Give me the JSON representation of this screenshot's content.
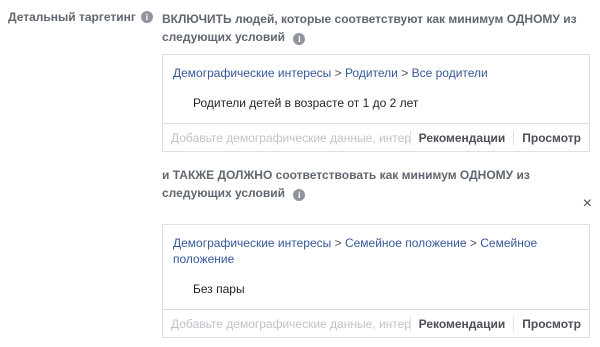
{
  "left_label": "Детальный таргетинг",
  "include": {
    "heading": "ВКЛЮЧИТЬ людей, которые соответствуют как минимум ОДНОМУ из следующих условий",
    "crumbs": [
      "Демографические интересы",
      "Родители",
      "Все родители"
    ],
    "item": "Родители детей в возрасте от 1 до 2 лет",
    "search_placeholder": "Добавьте демографические данные, интер...",
    "recommendations": "Рекомендации",
    "browse": "Просмотр"
  },
  "narrow": {
    "heading": "и ТАКЖЕ ДОЛЖНО соответствовать как минимум ОДНОМУ из следующих условий",
    "crumbs": [
      "Демографические интересы",
      "Семейное положение",
      "Семейное положение"
    ],
    "item": "Без пары",
    "search_placeholder": "Добавьте демографические данные, интер...",
    "recommendations": "Рекомендации",
    "browse": "Просмотр"
  },
  "close_symbol": "×",
  "info_symbol": "i",
  "crumb_separator": ">"
}
